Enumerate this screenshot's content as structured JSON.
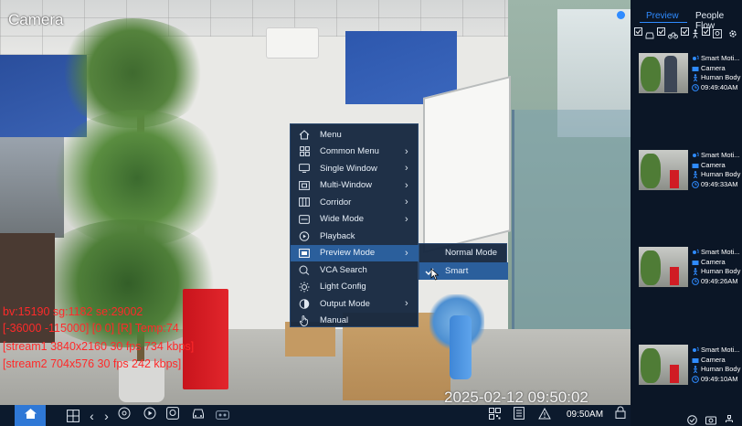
{
  "camera": {
    "title": "Camera",
    "timestamp": "2025-02-12 09:50:02",
    "osd_lines": [
      "bv:15190 sg:1182 se:29002",
      "[-36000 -115000] [0 0] [R] Temp:74",
      "[stream1 3840x2160 30 fps 734 kbps]",
      "[stream2 704x576 30 fps 242 kbps]"
    ]
  },
  "context_menu": {
    "items": [
      {
        "label": "Menu",
        "icon": "home-icon",
        "has_submenu": false
      },
      {
        "label": "Common Menu",
        "icon": "grid-icon",
        "has_submenu": true
      },
      {
        "label": "Single Window",
        "icon": "monitor-icon",
        "has_submenu": true
      },
      {
        "label": "Multi-Window",
        "icon": "multi-window-icon",
        "has_submenu": true
      },
      {
        "label": "Corridor",
        "icon": "corridor-icon",
        "has_submenu": true
      },
      {
        "label": "Wide Mode",
        "icon": "wide-mode-icon",
        "has_submenu": true
      },
      {
        "label": "Playback",
        "icon": "playback-icon",
        "has_submenu": false
      },
      {
        "label": "Preview Mode",
        "icon": "preview-mode-icon",
        "has_submenu": true,
        "active": true
      },
      {
        "label": "VCA Search",
        "icon": "search-icon",
        "has_submenu": false
      },
      {
        "label": "Light Config",
        "icon": "light-icon",
        "has_submenu": false
      },
      {
        "label": "Output Mode",
        "icon": "output-mode-icon",
        "has_submenu": true
      },
      {
        "label": "Manual",
        "icon": "hand-icon",
        "has_submenu": false
      }
    ],
    "submenu": {
      "items": [
        {
          "label": "Normal Mode",
          "checked": false
        },
        {
          "label": "Smart",
          "checked": true
        }
      ]
    }
  },
  "right_panel": {
    "tabs": [
      {
        "label": "Preview",
        "active": true
      },
      {
        "label": "People Flow",
        "active": false
      }
    ],
    "events": [
      {
        "type": "Smart Moti...",
        "source": "Camera",
        "target": "Human Body",
        "time": "09:49:40AM"
      },
      {
        "type": "Smart Moti...",
        "source": "Camera",
        "target": "Human Body",
        "time": "09:49:33AM"
      },
      {
        "type": "Smart Moti...",
        "source": "Camera",
        "target": "Human Body",
        "time": "09:49:26AM"
      },
      {
        "type": "Smart Moti...",
        "source": "Camera",
        "target": "Human Body",
        "time": "09:49:10AM"
      }
    ]
  },
  "bottom_bar": {
    "clock": "09:50AM"
  },
  "colors": {
    "accent": "#2f78d6",
    "menu_bg": "#14263e",
    "menu_highlight": "#2b5f9c",
    "osd_red": "#ff2a2a",
    "panel_bg": "#0b1626"
  }
}
